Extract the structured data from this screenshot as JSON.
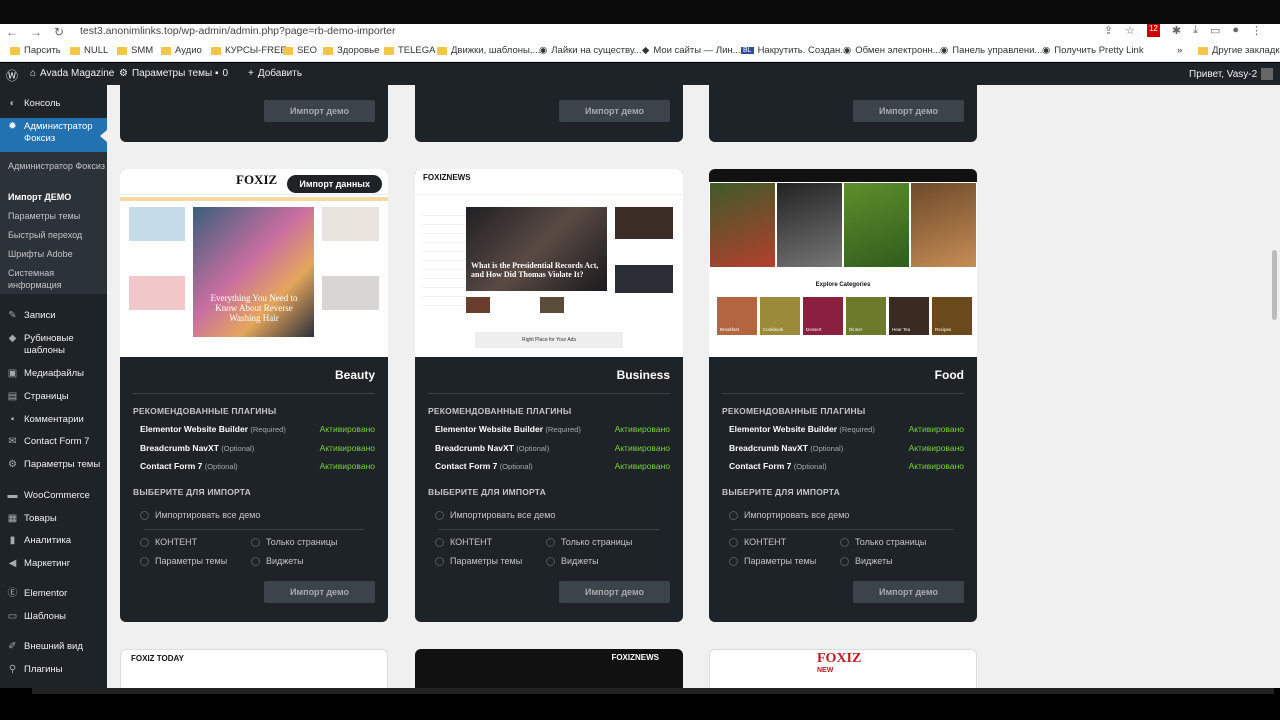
{
  "browser": {
    "url": "test3.anonimlinks.top/wp-admin/admin.php?page=rb-demo-importer",
    "bookmarks": [
      "Парсить",
      "NULL",
      "SMM",
      "Аудио",
      "КУРСЫ-FREE",
      "SEO",
      "Здоровье",
      "TELEGA",
      "Движки, шаблоны,...",
      "Лайки на существу...",
      "Мои сайты — Лин...",
      "Накрутить. Создан...",
      "Обмен электронн...",
      "Панель управлени...",
      "Получить Pretty Link",
      "Другие закладки"
    ],
    "bookmark_badge": "BL",
    "ext_badge": "12"
  },
  "adminbar": {
    "site": "Avada Magazine",
    "theme": "Параметры темы",
    "comments": "0",
    "add": "Добавить",
    "greeting": "Привет, Vasy-2"
  },
  "sidebar": {
    "items": [
      "Консоль",
      "Администратор Фоксиз",
      "Записи",
      "Рубиновые шаблоны",
      "Медиафайлы",
      "Страницы",
      "Комментарии",
      "Contact Form 7",
      "Параметры темы",
      "WooCommerce",
      "Товары",
      "Аналитика",
      "Маркетинг",
      "Elementor",
      "Шаблоны",
      "Внешний вид",
      "Плагины"
    ],
    "submenu": [
      "Администратор Фоксиз",
      "Импорт ДЕМО",
      "Параметры темы",
      "Быстрый переход",
      "Шрифты Adobe",
      "Системная информация"
    ]
  },
  "cards_common": {
    "rec_plugins": "РЕКОМЕНДОВАННЫЕ ПЛАГИНЫ",
    "plugins": [
      {
        "name": "Elementor Website Builder",
        "note": "(Required)",
        "status": "Активировано"
      },
      {
        "name": "Breadcrumb NavXT",
        "note": "(Optional)",
        "status": "Активировано"
      },
      {
        "name": "Contact Form 7",
        "note": "(Optional)",
        "status": "Активировано"
      }
    ],
    "choose": "ВЫБЕРИТЕ ДЛЯ ИМПОРТА",
    "import_all": "Импортировать все демо",
    "content": "КОНТЕНТ",
    "pages_only": "Только страницы",
    "theme_options": "Параметры темы",
    "widgets": "Виджеты",
    "button": "Импорт демо"
  },
  "cards": [
    {
      "title": "Beauty",
      "badge": "Импорт данных",
      "logo": "FOXIZ",
      "hero": "Everything You Need to Know About Reverse Washing Hair"
    },
    {
      "title": "Business",
      "logo": "FOXIZNEWS",
      "hero": "What is the Presidential Records Act, and How Did Thomas Violate It?",
      "ad": "Right Place for Your Ads"
    },
    {
      "title": "Food",
      "explore": "Explore Categories",
      "chips": [
        "Breakfast",
        "Cookbook",
        "Dessert",
        "Dinner",
        "Hear Tea",
        "Recipes"
      ]
    }
  ],
  "bottom_cards": [
    {
      "logo": "FOXIZ TODAY"
    },
    {
      "logo": "FOXIZNEWS"
    },
    {
      "logo": "FOXIZ",
      "sub": "NEW"
    }
  ],
  "colors": {
    "accent": "#2271b1",
    "active": "#7ad03a",
    "admin": "#1d2327"
  }
}
